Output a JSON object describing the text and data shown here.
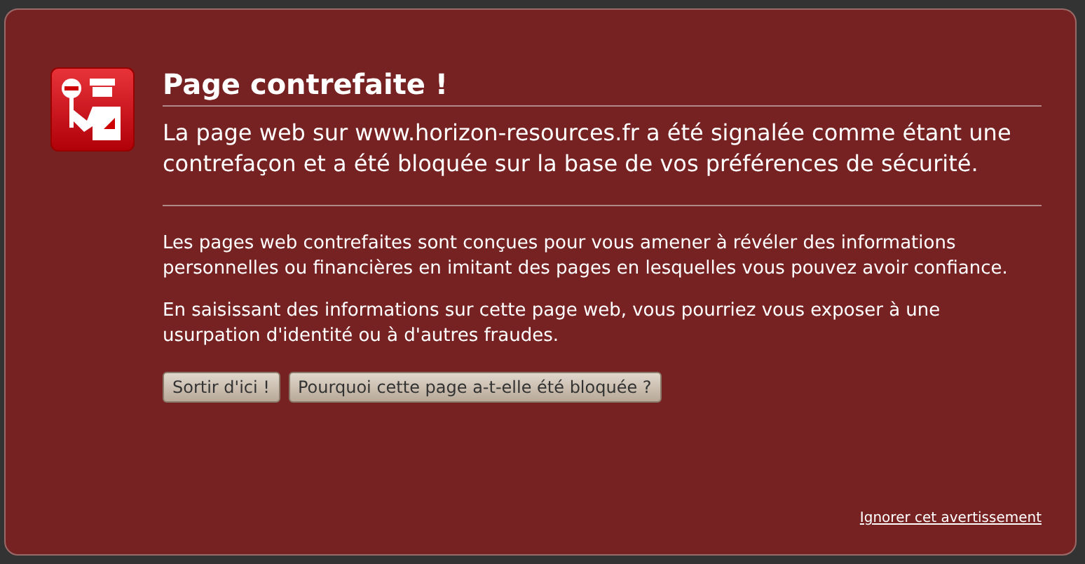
{
  "title": "Page contrefaite !",
  "short_desc": "La page web sur www.horizon-resources.fr a été signalée comme étant une contrefaçon et a été bloquée sur la base de vos préférences de sécurité.",
  "long_desc": [
    "Les pages web contrefaites sont conçues pour vous amener à révéler des informations personnelles ou financières en imitant des pages en lesquelles vous pouvez avoir confiance.",
    "En saisissant des informations sur cette page web, vous pourriez vous exposer à une usurpation d'identité ou à d'autres fraudes."
  ],
  "buttons": [
    "Sortir d'ici !",
    "Pourquoi cette page a-t-elle été bloquée ?"
  ],
  "ignore_link": "Ignorer cet avertissement"
}
